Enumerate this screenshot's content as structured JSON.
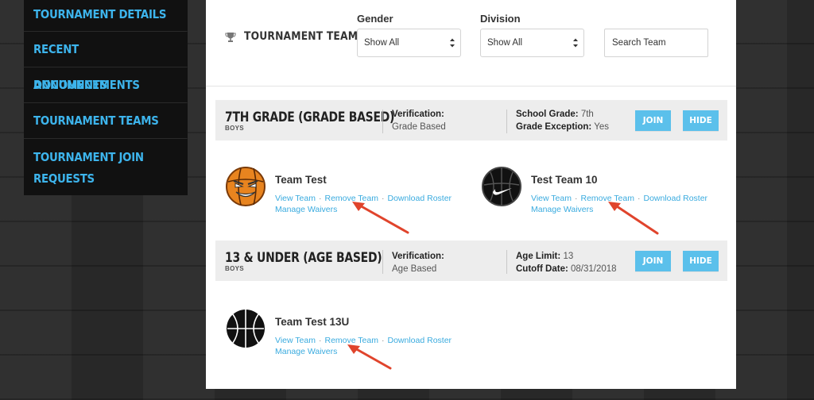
{
  "sidebar": {
    "items": [
      {
        "label": "TOURNAMENT DETAILS"
      },
      {
        "label": "RECENT ANNOUNCEMENTS"
      },
      {
        "label": "DOCUMENTS"
      },
      {
        "label": "TOURNAMENT TEAMS"
      },
      {
        "label_line1": "TOURNAMENT JOIN",
        "label_line2": "REQUESTS"
      }
    ]
  },
  "header": {
    "title": "TOURNAMENT TEAMS",
    "icon": "trophy-icon",
    "gender": {
      "label": "Gender",
      "value": "Show All"
    },
    "division": {
      "label": "Division",
      "value": "Show All"
    },
    "search": {
      "placeholder": "Search Team"
    }
  },
  "divisions": [
    {
      "name": "7TH GRADE (GRADE BASED)",
      "gender": "BOYS",
      "verification_label": "Verification:",
      "verification_value": "Grade Based",
      "detail1_label": "School Grade:",
      "detail1_value": "7th",
      "detail2_label": "Grade Exception:",
      "detail2_value": "Yes",
      "join_label": "JOIN",
      "hide_label": "HIDE",
      "teams": [
        {
          "name": "Team Test",
          "logo": "angry-basketball-logo",
          "links": {
            "view": "View Team",
            "remove": "Remove Team",
            "download": "Download Roster",
            "waivers": "Manage Waivers"
          }
        },
        {
          "name": "Test Team 10",
          "logo": "nike-basketball-logo",
          "links": {
            "view": "View Team",
            "remove": "Remove Team",
            "download": "Download Roster",
            "waivers": "Manage Waivers"
          }
        }
      ]
    },
    {
      "name": "13 & UNDER (AGE BASED)",
      "gender": "BOYS",
      "verification_label": "Verification:",
      "verification_value": "Age Based",
      "detail1_label": "Age Limit:",
      "detail1_value": "13",
      "detail2_label": "Cutoff Date:",
      "detail2_value": "08/31/2018",
      "join_label": "JOIN",
      "hide_label": "HIDE",
      "teams": [
        {
          "name": "Team Test 13U",
          "logo": "black-basketball-logo",
          "links": {
            "view": "View Team",
            "remove": "Remove Team",
            "download": "Download Roster",
            "waivers": "Manage Waivers"
          }
        }
      ]
    }
  ],
  "colors": {
    "accent": "#3db4ec",
    "button": "#5bc0eb",
    "link": "#3aabdf",
    "annotation_arrow": "#e0442c"
  }
}
